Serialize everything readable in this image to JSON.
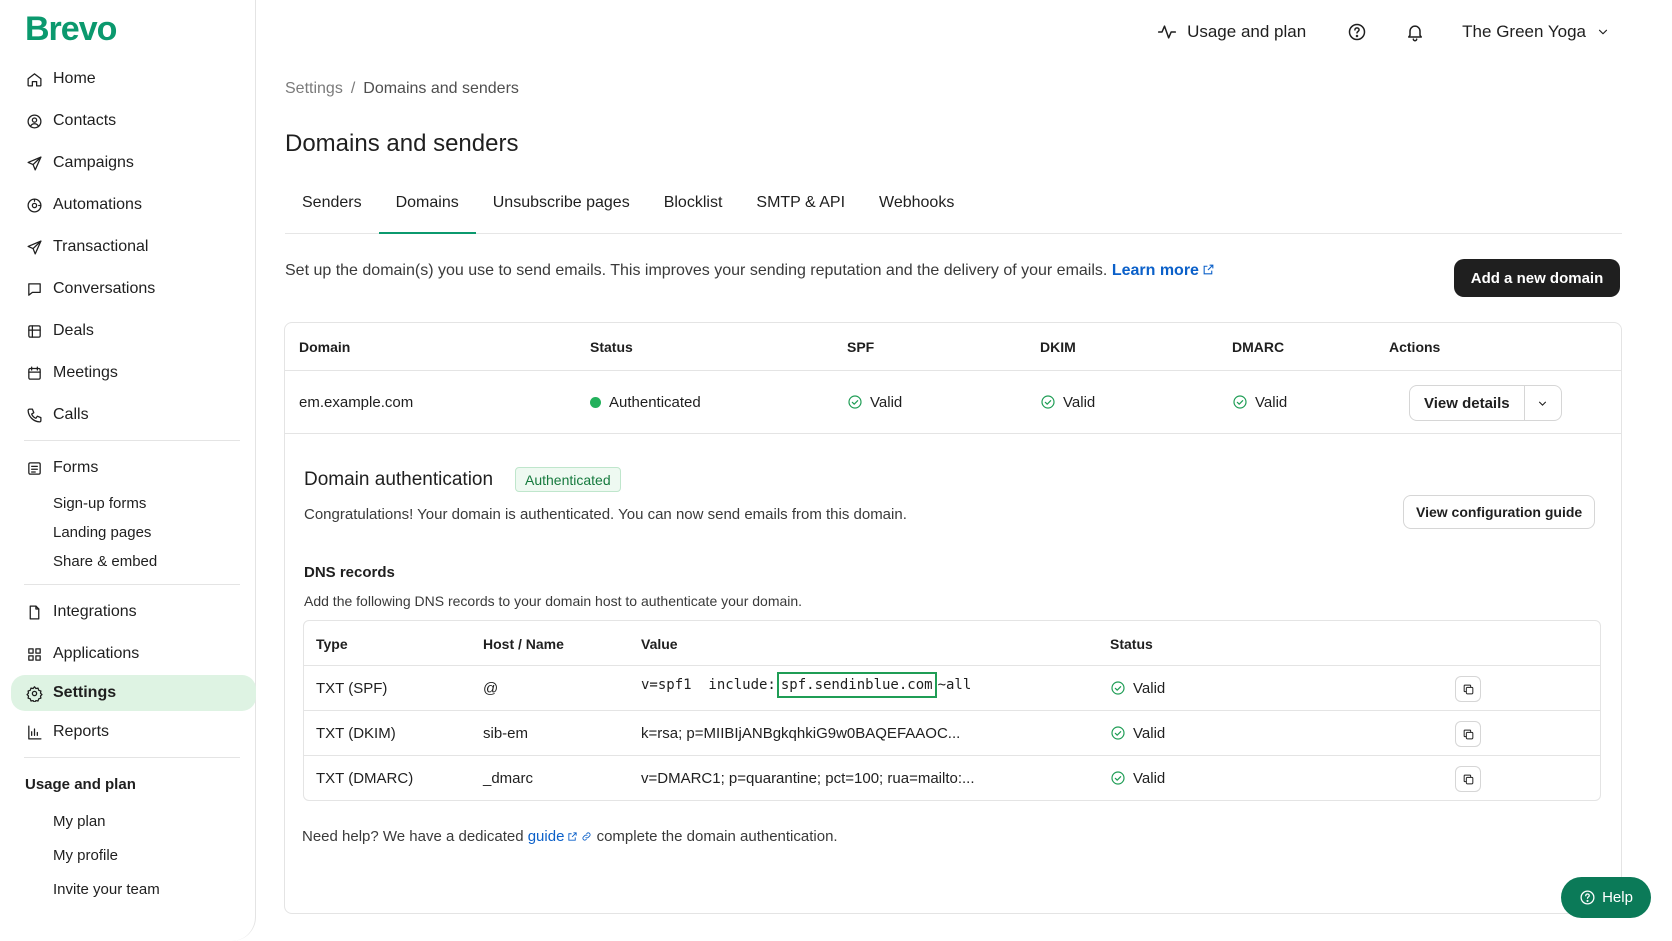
{
  "brand": {
    "logo": "Brevo",
    "color": "#0b996e"
  },
  "sidebar": {
    "items": [
      {
        "label": "Home",
        "icon": "home-icon"
      },
      {
        "label": "Contacts",
        "icon": "contacts-icon"
      },
      {
        "label": "Campaigns",
        "icon": "send-icon"
      },
      {
        "label": "Automations",
        "icon": "automation-icon"
      },
      {
        "label": "Transactional",
        "icon": "send-icon"
      },
      {
        "label": "Conversations",
        "icon": "chat-icon"
      },
      {
        "label": "Deals",
        "icon": "deals-icon"
      },
      {
        "label": "Meetings",
        "icon": "calendar-icon"
      },
      {
        "label": "Calls",
        "icon": "phone-icon"
      }
    ],
    "forms": {
      "label": "Forms",
      "icon": "forms-icon",
      "sub": [
        "Sign-up forms",
        "Landing pages",
        "Share & embed"
      ]
    },
    "items2": [
      {
        "label": "Integrations",
        "icon": "integrations-icon"
      },
      {
        "label": "Applications",
        "icon": "apps-icon"
      },
      {
        "label": "Settings",
        "icon": "gear-icon",
        "active": true
      },
      {
        "label": "Reports",
        "icon": "reports-icon"
      }
    ],
    "usage_heading": "Usage and plan",
    "usage_sub": [
      "My plan",
      "My profile",
      "Invite your team"
    ]
  },
  "topbar": {
    "usage_label": "Usage and plan",
    "account_name": "The Green Yoga"
  },
  "breadcrumb": {
    "parent": "Settings",
    "separator": "/",
    "current": "Domains and senders"
  },
  "page_title": "Domains and senders",
  "tabs": [
    {
      "label": "Senders",
      "active": false
    },
    {
      "label": "Domains",
      "active": true
    },
    {
      "label": "Unsubscribe pages",
      "active": false
    },
    {
      "label": "Blocklist",
      "active": false
    },
    {
      "label": "SMTP & API",
      "active": false
    },
    {
      "label": "Webhooks",
      "active": false
    }
  ],
  "intro": {
    "text": "Set up the domain(s) you use to send emails. This improves your sending reputation and the delivery of your emails. ",
    "link": "Learn more"
  },
  "add_domain_label": "Add a new domain",
  "domains_table": {
    "headers": {
      "domain": "Domain",
      "status": "Status",
      "spf": "SPF",
      "dkim": "DKIM",
      "dmarc": "DMARC",
      "actions": "Actions"
    },
    "row": {
      "domain": "em.example.com",
      "status": "Authenticated",
      "spf": "Valid",
      "dkim": "Valid",
      "dmarc": "Valid",
      "action_label": "View details"
    }
  },
  "auth": {
    "title": "Domain authentication",
    "badge": "Authenticated",
    "description": "Congratulations! Your domain is authenticated. You can now send emails from this domain.",
    "config_guide_label": "View configuration guide"
  },
  "dns": {
    "title": "DNS records",
    "description": "Add the following DNS records to your domain host to authenticate your domain.",
    "headers": {
      "type": "Type",
      "host": "Host / Name",
      "value": "Value",
      "status": "Status"
    },
    "rows": [
      {
        "type": "TXT (SPF)",
        "host": "@",
        "value_pre": "v=spf1  include:",
        "value_hl": "spf.sendinblue.com",
        "value_post": "~all",
        "status": "Valid"
      },
      {
        "type": "TXT (DKIM)",
        "host": "sib-em",
        "value": "k=rsa; p=MIIBIjANBgkqhkiG9w0BAQEFAAOC...",
        "status": "Valid"
      },
      {
        "type": "TXT (DMARC)",
        "host": "_dmarc",
        "value": "v=DMARC1; p=quarantine; pct=100; rua=mailto:...",
        "status": "Valid"
      }
    ]
  },
  "help_line": {
    "pre": "Need help? We have a dedicated ",
    "link": "guide",
    "post": " complete the domain authentication."
  },
  "help_button_label": "Help"
}
